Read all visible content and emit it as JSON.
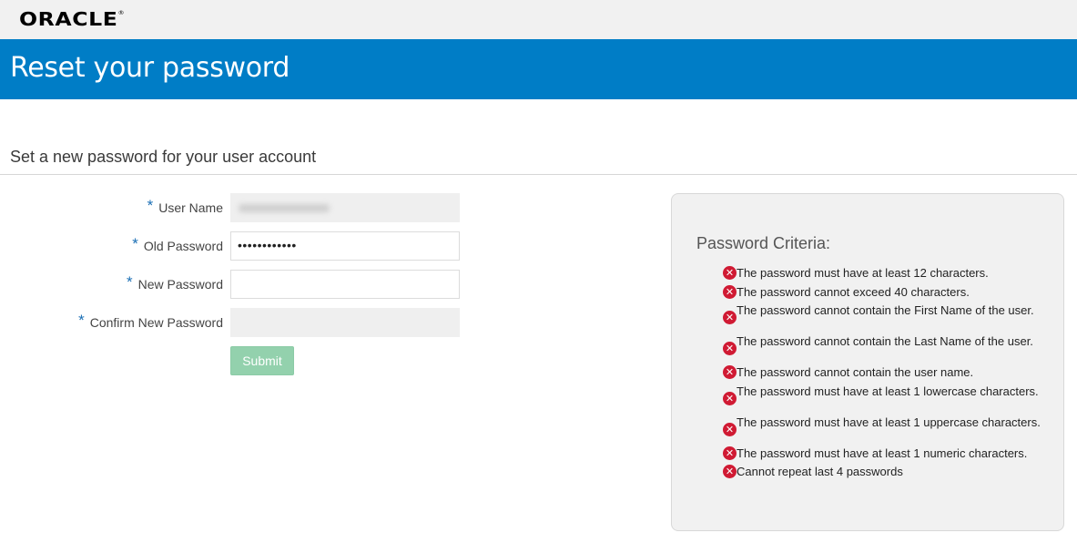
{
  "header": {
    "brand": "ORACLE",
    "trademark": "®"
  },
  "banner": {
    "title": "Reset your password"
  },
  "form": {
    "subtitle": "Set a new password for your user account",
    "required_marker": "*",
    "fields": [
      {
        "label": "User Name",
        "value": "",
        "state": "disabled"
      },
      {
        "label": "Old Password",
        "value": "••••••••••••",
        "state": "filled"
      },
      {
        "label": "New Password",
        "value": "",
        "state": "empty"
      },
      {
        "label": "Confirm New Password",
        "value": "",
        "state": "disabled"
      }
    ],
    "submit_label": "Submit"
  },
  "criteria": {
    "title": "Password Criteria:",
    "icon": "error-x-icon",
    "items": [
      "The password must have at least 12 characters.",
      "The password cannot exceed 40 characters.",
      "The password cannot contain the First Name of the user.",
      "The password cannot contain the Last Name of the user.",
      "The password cannot contain the user name.",
      "The password must have at least 1 lowercase characters.",
      "The password must have at least 1 uppercase characters.",
      "The password must have at least 1 numeric characters.",
      "Cannot repeat last 4 passwords"
    ]
  },
  "colors": {
    "banner": "#007dc6",
    "submit": "#93d1ad",
    "error_icon": "#d01a33",
    "required": "#1b6fb5"
  }
}
